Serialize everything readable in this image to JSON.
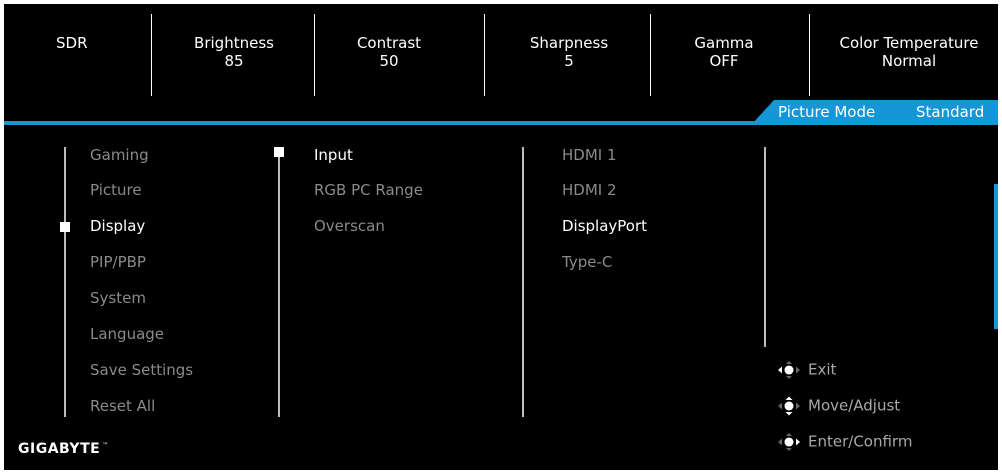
{
  "status_bar": {
    "hdr_mode": "SDR",
    "brightness": {
      "label": "Brightness",
      "value": "85"
    },
    "contrast": {
      "label": "Contrast",
      "value": "50"
    },
    "sharpness": {
      "label": "Sharpness",
      "value": "5"
    },
    "gamma": {
      "label": "Gamma",
      "value": "OFF"
    },
    "color_temperature": {
      "label": "Color Temperature",
      "value": "Normal"
    }
  },
  "picture_mode": {
    "label": "Picture Mode",
    "value": "Standard"
  },
  "main_menu": {
    "items": [
      "Gaming",
      "Picture",
      "Display",
      "PIP/PBP",
      "System",
      "Language",
      "Save Settings",
      "Reset All"
    ],
    "selected": "Display"
  },
  "sub_menu": {
    "items": [
      "Input",
      "RGB PC Range",
      "Overscan"
    ],
    "selected": "Input"
  },
  "options": {
    "items": [
      "HDMI 1",
      "HDMI 2",
      "DisplayPort",
      "Type-C"
    ],
    "selected": "DisplayPort"
  },
  "hints": {
    "exit": "Exit",
    "move": "Move/Adjust",
    "confirm": "Enter/Confirm"
  },
  "brand": {
    "name": "GIGABYTE",
    "tm": "™"
  },
  "colors": {
    "accent": "#1596d6",
    "background": "#000000",
    "inactive_text": "#8a8a8a"
  }
}
